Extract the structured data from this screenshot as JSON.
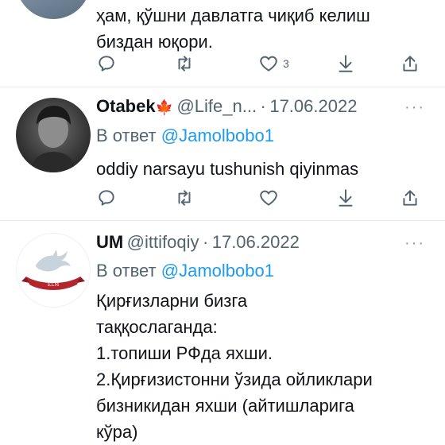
{
  "tweets": [
    {
      "text_lines": [
        "ҳам, қўшни давлатга чиқиб келиш",
        "биздан юқори."
      ],
      "actions": {
        "reply_icon": "reply-icon",
        "retweet_icon": "retweet-icon",
        "like_icon": "heart-icon",
        "like_count": "3",
        "bookmark_icon": "bookmark-arrow-icon",
        "share_icon": "share-icon"
      }
    },
    {
      "name": "Otabek",
      "name_emoji": "🍁",
      "handle": "@Life_n...",
      "sep": "·",
      "date": "17.06.2022",
      "reply_prefix": "В ответ",
      "reply_to": "@Jamolbobo1",
      "text_lines": [
        "oddiy narsayu tushunish qiyinmas"
      ],
      "more": "···"
    },
    {
      "name": "UM",
      "handle": "@ittifoqiy",
      "sep": "·",
      "date": "17.06.2022",
      "reply_prefix": "В ответ",
      "reply_to": "@Jamolbobo1",
      "text_lines": [
        "Қирғизларни бизга",
        "таққослаганда:",
        "1.топиши РФда яхши.",
        "2.Қирғизистонни ўзида ойликлари",
        "бизникидан яхши (айтишларига",
        "кўра)"
      ],
      "more": "···"
    }
  ]
}
